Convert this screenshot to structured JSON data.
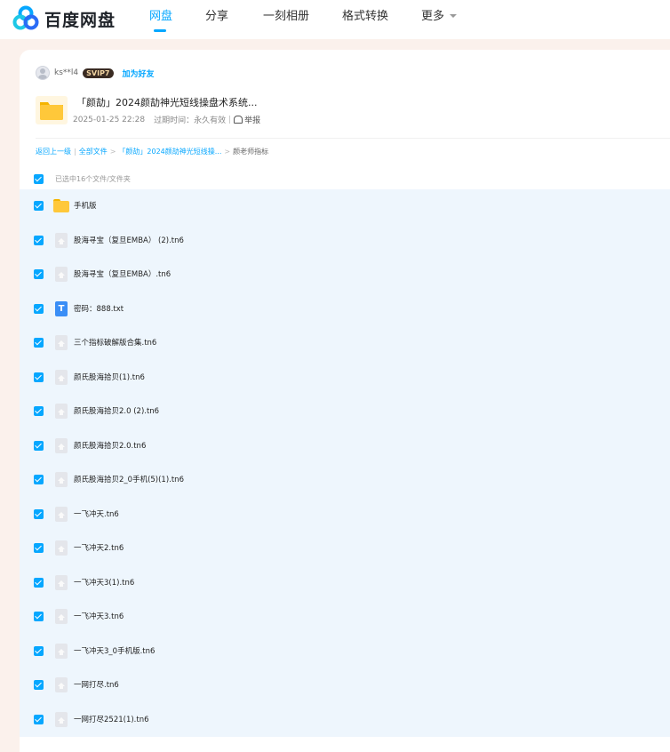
{
  "brand": {
    "name": "百度网盘"
  },
  "nav": {
    "items": [
      {
        "label": "网盘",
        "active": true
      },
      {
        "label": "分享",
        "active": false
      },
      {
        "label": "一刻相册",
        "active": false
      },
      {
        "label": "格式转换",
        "active": false
      },
      {
        "label": "更多",
        "active": false
      }
    ]
  },
  "share": {
    "user": "ks**l4",
    "badge": "SVIP7",
    "add_friend": "加为好友",
    "title": "「颜劼」2024颜劼神光短线操盘术系统...",
    "date": "2025-01-25 22:28",
    "expire_label": "过期时间：永久有效",
    "report": "举报"
  },
  "breadcrumb": {
    "back": "返回上一级",
    "sep_pipe": "|",
    "all_files": "全部文件",
    "parent": "「颜劼」2024颜劼神光短线操...",
    "sep": ">",
    "current": "颜老师指标"
  },
  "selection": {
    "text": "已选中16个文件/文件夹"
  },
  "files": [
    {
      "name": "手机版",
      "icon": "folder-icon"
    },
    {
      "name": "股海寻宝（复旦EMBA） (2).tn6",
      "icon": "file-icon"
    },
    {
      "name": "股海寻宝（复旦EMBA）.tn6",
      "icon": "file-icon"
    },
    {
      "name": "密码：888.txt",
      "icon": "txt-icon"
    },
    {
      "name": "三个指标破解版合集.tn6",
      "icon": "file-icon"
    },
    {
      "name": "颜氏股海拾贝(1).tn6",
      "icon": "file-icon"
    },
    {
      "name": "颜氏股海拾贝2.0 (2).tn6",
      "icon": "file-icon"
    },
    {
      "name": "颜氏股海拾贝2.0.tn6",
      "icon": "file-icon"
    },
    {
      "name": "颜氏股海拾贝2_0手机(5)(1).tn6",
      "icon": "file-icon"
    },
    {
      "name": "一飞冲天.tn6",
      "icon": "file-icon"
    },
    {
      "name": "一飞冲天2.tn6",
      "icon": "file-icon"
    },
    {
      "name": "一飞冲天3(1).tn6",
      "icon": "file-icon"
    },
    {
      "name": "一飞冲天3.tn6",
      "icon": "file-icon"
    },
    {
      "name": "一飞冲天3_0手机版.tn6",
      "icon": "file-icon"
    },
    {
      "name": "一网打尽.tn6",
      "icon": "file-icon"
    },
    {
      "name": "一网打尽2521(1).tn6",
      "icon": "file-icon"
    }
  ],
  "colors": {
    "accent": "#06a7ff",
    "row_bg": "#eef6fd",
    "page_bg": "#fbf1ec"
  }
}
